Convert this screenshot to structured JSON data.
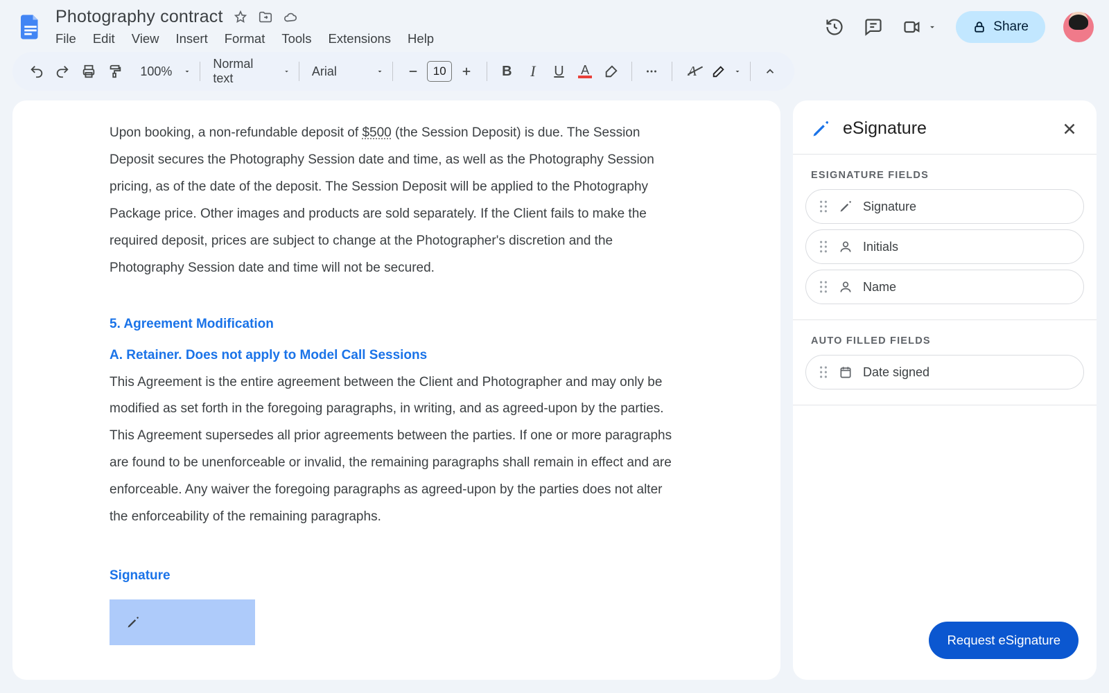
{
  "header": {
    "doc_title": "Photography contract",
    "menus": [
      "File",
      "Edit",
      "View",
      "Insert",
      "Format",
      "Tools",
      "Extensions",
      "Help"
    ],
    "share_label": "Share"
  },
  "toolbar": {
    "zoom": "100%",
    "styles": "Normal text",
    "font": "Arial",
    "font_size": "10"
  },
  "document": {
    "para1_a": "Upon booking, a non-refundable deposit of ",
    "amount": "$500",
    "para1_b": " (the Session Deposit) is due. The Session Deposit secures the Photography Session date and time, as well as the Photography Session pricing, as of the date of the deposit. The Session Deposit will be applied to the Photography Package price. Other images and products are sold separately. If the Client fails to make the required deposit, prices are subject to change at the Photographer's discretion and the Photography Session date and time will not be secured.",
    "section5_heading": "5. Agreement Modification",
    "section5_sub": "A. Retainer.  Does not apply to Model Call Sessions",
    "para2": "This Agreement is the entire agreement between the Client and Photographer and may only be modified as set forth in the foregoing paragraphs, in writing, and as agreed-upon by the parties.  This Agreement supersedes all prior agreements between the parties. If one or more paragraphs are found to be unenforceable or invalid, the remaining paragraphs shall remain in effect and are enforceable. Any waiver the foregoing paragraphs as agreed-upon by the parties does not alter the enforceability of the remaining paragraphs.",
    "sig_label": "Signature"
  },
  "sidebar": {
    "title": "eSignature",
    "section_esig_label": "ESIGNATURE FIELDS",
    "section_auto_label": "AUTO FILLED FIELDS",
    "fields_esig": [
      "Signature",
      "Initials",
      "Name"
    ],
    "fields_auto": [
      "Date signed"
    ],
    "request_label": "Request eSignature"
  }
}
